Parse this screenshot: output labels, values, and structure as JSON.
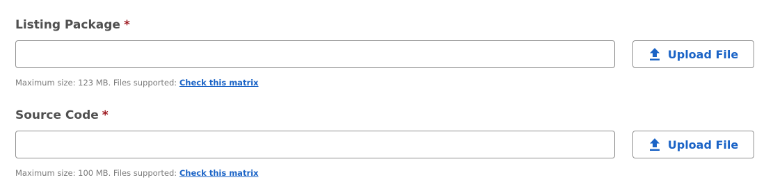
{
  "fields": [
    {
      "label": "Listing Package",
      "required_mark": "*",
      "value": "",
      "upload_label": "Upload File",
      "hint_text": "Maximum size: 123 MB. Files supported: ",
      "hint_link": "Check this matrix"
    },
    {
      "label": "Source Code",
      "required_mark": "*",
      "value": "",
      "upload_label": "Upload File",
      "hint_text": "Maximum size: 100 MB. Files supported: ",
      "hint_link": "Check this matrix"
    }
  ],
  "colors": {
    "accent": "#1a63c6",
    "required": "#9e1b22",
    "label": "#505050",
    "hint": "#7a7a7a",
    "border": "#8f8f8f"
  },
  "icons": {
    "upload": "upload-arrow-icon"
  }
}
